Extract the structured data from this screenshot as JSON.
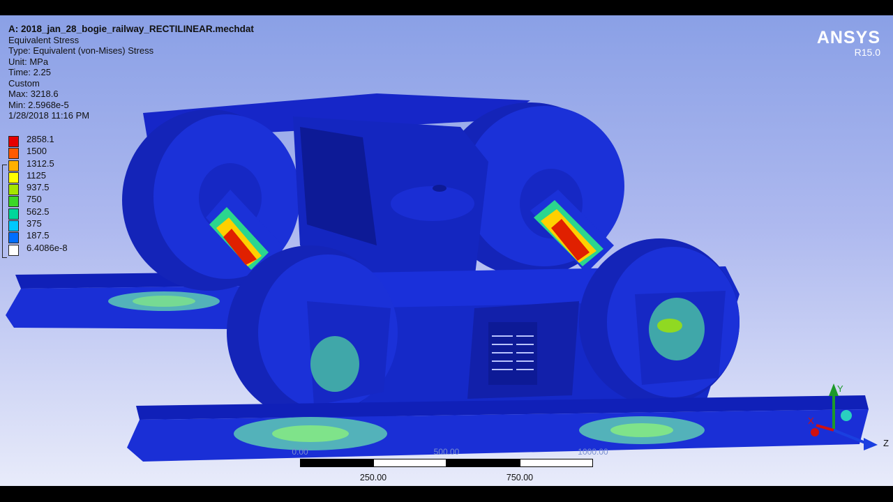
{
  "app": {
    "brand": "ANSYS",
    "version": "R15.0"
  },
  "info": {
    "title": "A: 2018_jan_28_bogie_railway_RECTILINEAR.mechdat",
    "result": "Equivalent Stress",
    "type": "Type: Equivalent (von-Mises) Stress",
    "unit": "Unit: MPa",
    "time": "Time: 2.25",
    "mode": "Custom",
    "max": "Max: 3218.6",
    "min": "Min: 2.5968e-5",
    "date": "1/28/2018 11:16 PM"
  },
  "legend": [
    {
      "value": "2858.1",
      "color": "#e50000"
    },
    {
      "value": "1500",
      "color": "#ff5a00"
    },
    {
      "value": "1312.5",
      "color": "#ffb000"
    },
    {
      "value": "1125",
      "color": "#ffff00"
    },
    {
      "value": "937.5",
      "color": "#a4e600"
    },
    {
      "value": "750",
      "color": "#3cd728"
    },
    {
      "value": "562.5",
      "color": "#00d79b"
    },
    {
      "value": "375",
      "color": "#00c8ff"
    },
    {
      "value": "187.5",
      "color": "#006eff"
    },
    {
      "value": "6.4086e-8",
      "color": "#ffffff"
    }
  ],
  "scale": {
    "tick_250": "250.00",
    "tick_750": "750.00",
    "ghost_0": "0.00",
    "ghost_500": "500.00",
    "ghost_1000": "1000.00"
  },
  "triad": {
    "y": "Y",
    "x": "X",
    "z": "Z"
  },
  "colors": {
    "model_blue": "#1a2fd6",
    "model_dark": "#0d1aa0"
  }
}
